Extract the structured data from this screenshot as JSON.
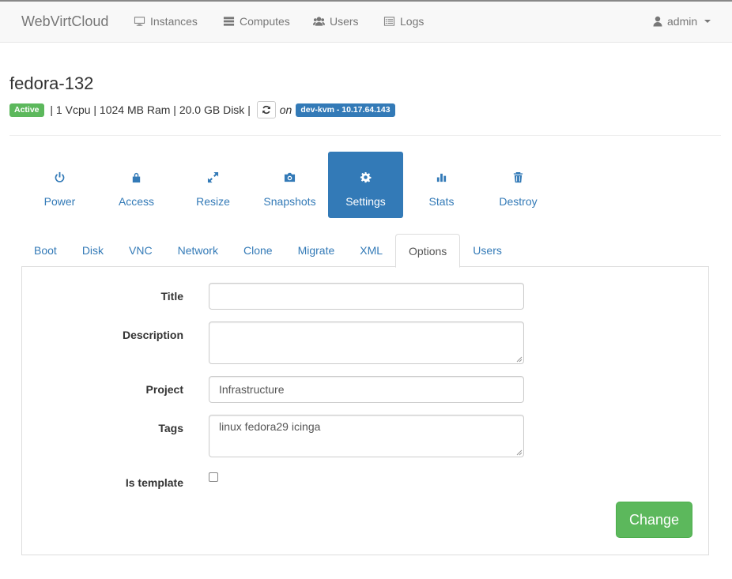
{
  "navbar": {
    "brand": "WebVirtCloud",
    "items": [
      {
        "label": "Instances",
        "icon": "desktop-icon"
      },
      {
        "label": "Computes",
        "icon": "server-icon"
      },
      {
        "label": "Users",
        "icon": "users-icon"
      },
      {
        "label": "Logs",
        "icon": "list-icon"
      }
    ],
    "user": {
      "label": "admin",
      "icon": "user-icon"
    }
  },
  "instance": {
    "name": "fedora-132",
    "status": "Active",
    "specs": " | 1 Vcpu | 1024 MB Ram | 20.0 GB Disk | ",
    "on_text": "on",
    "host": "dev-kvm - 10.17.64.143"
  },
  "actions": [
    {
      "label": "Power",
      "icon": "power-icon"
    },
    {
      "label": "Access",
      "icon": "lock-icon"
    },
    {
      "label": "Resize",
      "icon": "resize-icon"
    },
    {
      "label": "Snapshots",
      "icon": "camera-icon"
    },
    {
      "label": "Settings",
      "icon": "gear-icon",
      "active": true
    },
    {
      "label": "Stats",
      "icon": "bar-chart-icon"
    },
    {
      "label": "Destroy",
      "icon": "trash-icon"
    }
  ],
  "tabs": [
    {
      "label": "Boot"
    },
    {
      "label": "Disk"
    },
    {
      "label": "VNC"
    },
    {
      "label": "Network"
    },
    {
      "label": "Clone"
    },
    {
      "label": "Migrate"
    },
    {
      "label": "XML"
    },
    {
      "label": "Options",
      "active": true
    },
    {
      "label": "Users"
    }
  ],
  "form": {
    "title_label": "Title",
    "title_value": "",
    "description_label": "Description",
    "description_value": "",
    "project_label": "Project",
    "project_value": "Infrastructure",
    "tags_label": "Tags",
    "tags_value": "linux fedora29 icinga",
    "template_label": "Is template",
    "template_checked": false,
    "submit_label": "Change"
  },
  "colors": {
    "primary": "#337ab7",
    "success": "#5cb85c",
    "navbar_bg": "#f8f8f8"
  }
}
